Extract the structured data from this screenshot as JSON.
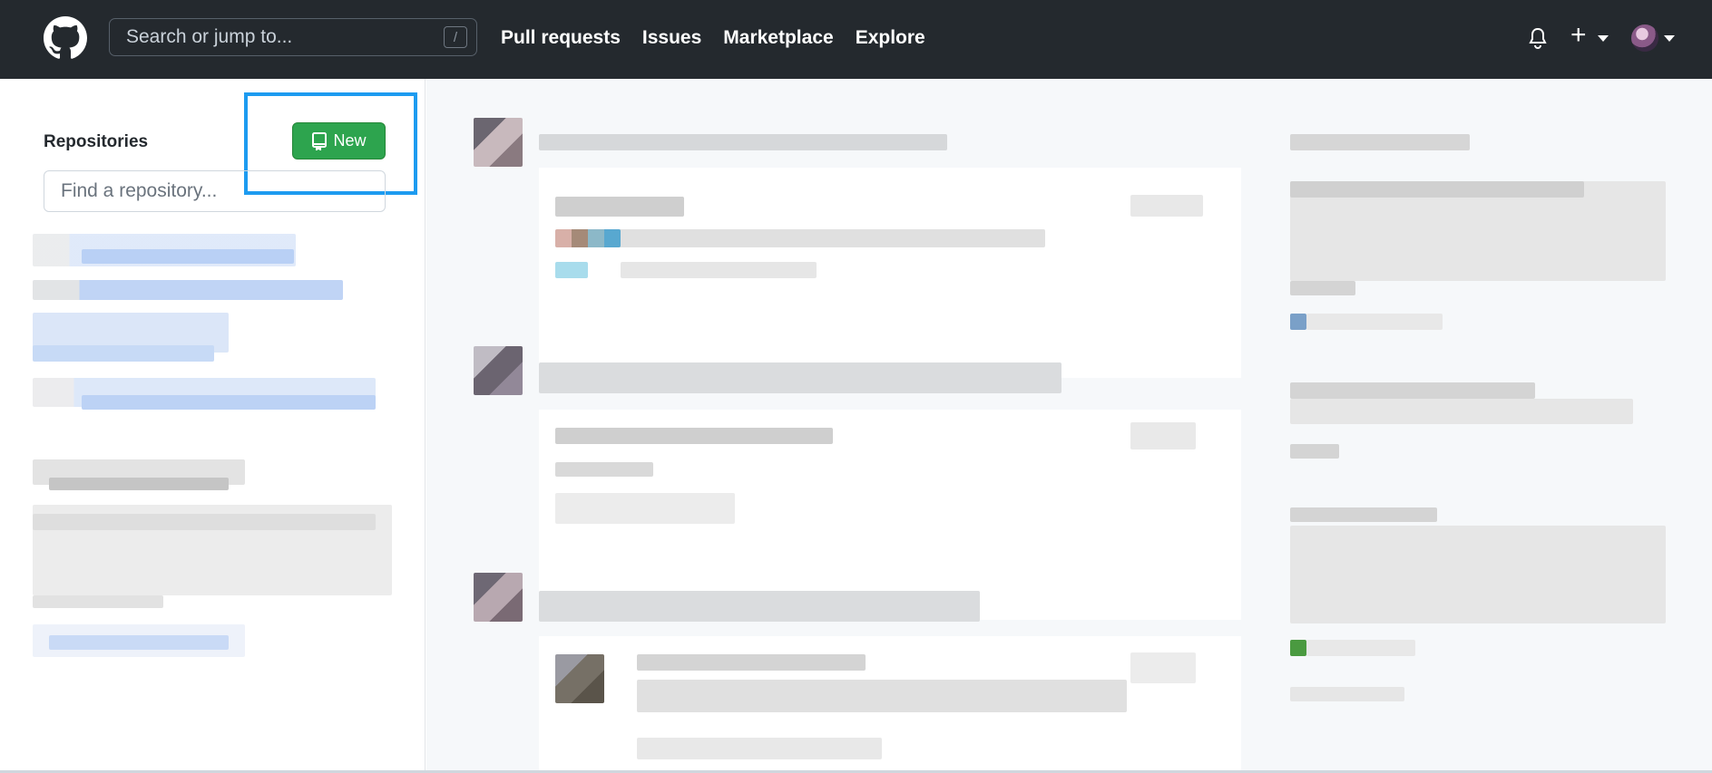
{
  "header": {
    "search_placeholder": "Search or jump to...",
    "search_shortcut": "/",
    "nav": [
      "Pull requests",
      "Issues",
      "Marketplace",
      "Explore"
    ]
  },
  "sidebar": {
    "title": "Repositories",
    "new_button": "New",
    "find_placeholder": "Find a repository..."
  },
  "colors": {
    "header_bg": "#24292e",
    "new_button_bg": "#2da44e",
    "highlight": "#1d9bf0"
  }
}
